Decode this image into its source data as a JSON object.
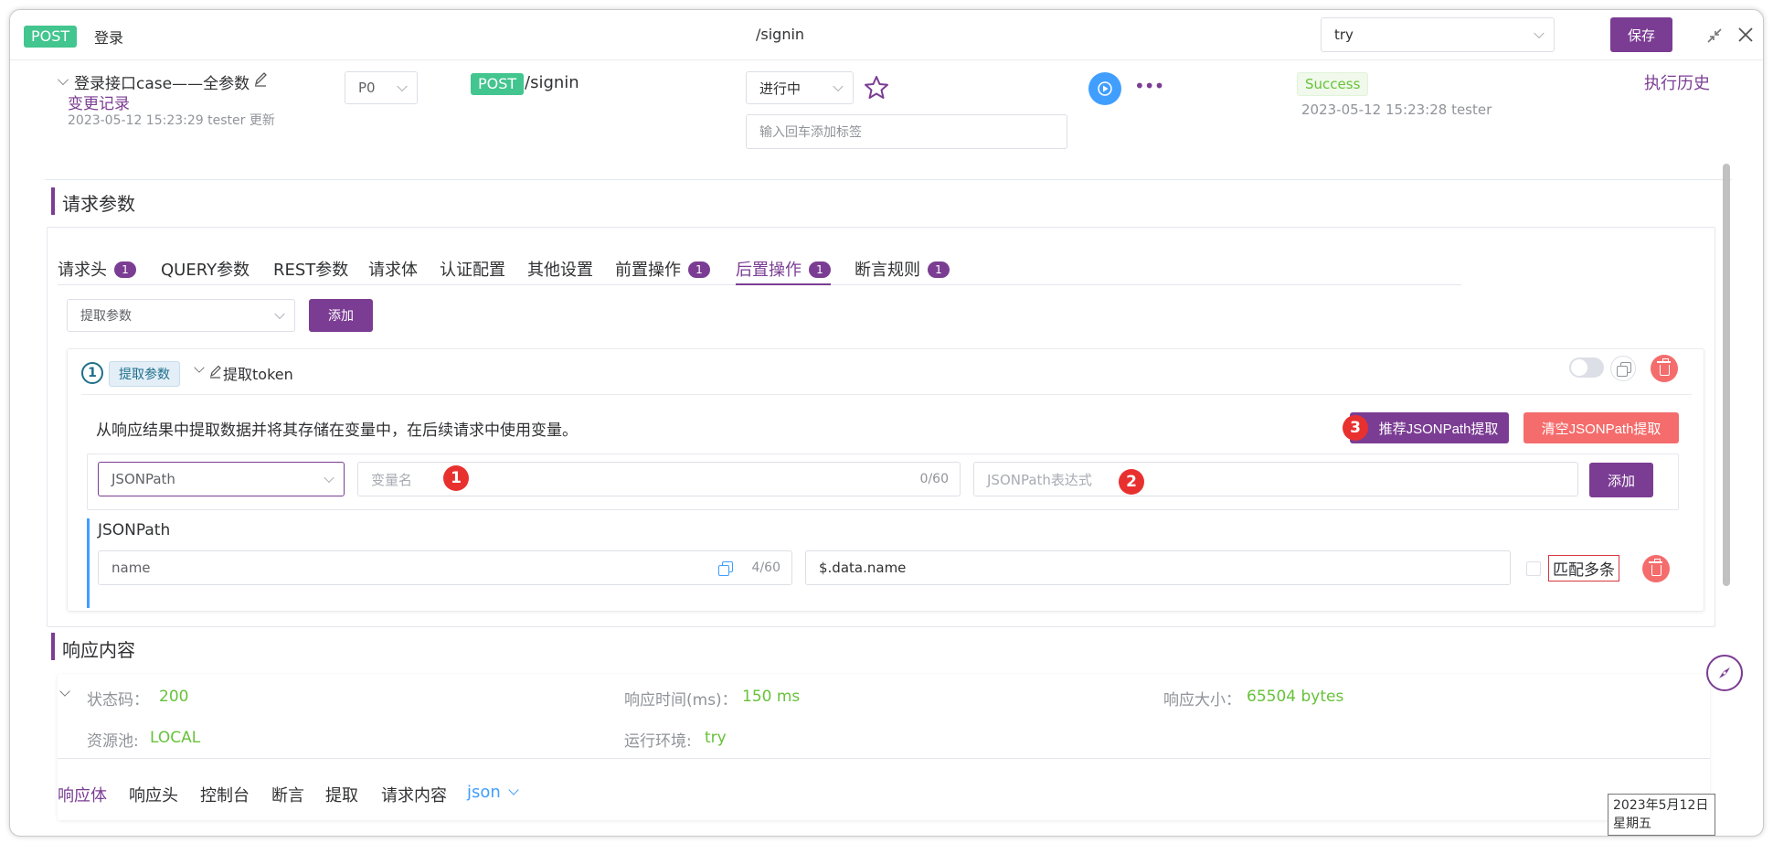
{
  "header": {
    "method": "POST",
    "name": "登录",
    "path": "/signin",
    "env_select": "try",
    "save_label": "保存"
  },
  "case": {
    "title": "登录接口case——全参数",
    "change_log": "变更记录",
    "updated": "2023-05-12 15:23:29 tester 更新",
    "priority": "P0",
    "method": "POST",
    "path": "/signin",
    "status": "进行中",
    "tag_placeholder": "输入回车添加标签",
    "result": "Success",
    "run_info": "2023-05-12 15:23:28 tester",
    "history": "执行历史"
  },
  "request": {
    "section_title": "请求参数",
    "tabs": [
      {
        "label": "请求头",
        "badge": "1"
      },
      {
        "label": "QUERY参数",
        "badge": ""
      },
      {
        "label": "REST参数",
        "badge": ""
      },
      {
        "label": "请求体",
        "badge": ""
      },
      {
        "label": "认证配置",
        "badge": ""
      },
      {
        "label": "其他设置",
        "badge": ""
      },
      {
        "label": "前置操作",
        "badge": "1"
      },
      {
        "label": "后置操作",
        "badge": "1"
      },
      {
        "label": "断言规则",
        "badge": "1"
      }
    ],
    "active_tab": "后置操作",
    "add_type_select": "提取参数",
    "add_label": "添加",
    "processor": {
      "index": "1",
      "type_tag": "提取参数",
      "name": "提取token",
      "description": "从响应结果中提取数据并将其存储在变量中，在后续请求中使用变量。",
      "recommend_label": "推荐JSONPath提取",
      "clear_label": "清空JSONPath提取",
      "extract_type": "JSONPath",
      "var_placeholder": "变量名",
      "var_count": "0/60",
      "expr_placeholder": "JSONPath表达式",
      "add_label": "添加",
      "list_title": "JSONPath",
      "rows": [
        {
          "name": "name",
          "count": "4/60",
          "expr": "$.data.name",
          "match_multi": "匹配多条"
        }
      ]
    },
    "markers": [
      "1",
      "2",
      "3"
    ]
  },
  "response": {
    "section_title": "响应内容",
    "status_label": "状态码：",
    "status_value": "200",
    "time_label": "响应时间(ms)：",
    "time_value": "150 ms",
    "size_label": "响应大小：",
    "size_value": "65504 bytes",
    "pool_label": "资源池:",
    "pool_value": "LOCAL",
    "env_label": "运行环境:",
    "env_value": "try",
    "tabs": [
      "响应体",
      "响应头",
      "控制台",
      "断言",
      "提取",
      "请求内容"
    ],
    "format": "json"
  },
  "tooltip": {
    "date": "2023年5月12日",
    "weekday": "星期五"
  },
  "colors": {
    "primary": "#7b3d93",
    "success": "#67c23a",
    "danger": "#f56c6c",
    "post": "#42c58e",
    "run": "#409eff"
  }
}
